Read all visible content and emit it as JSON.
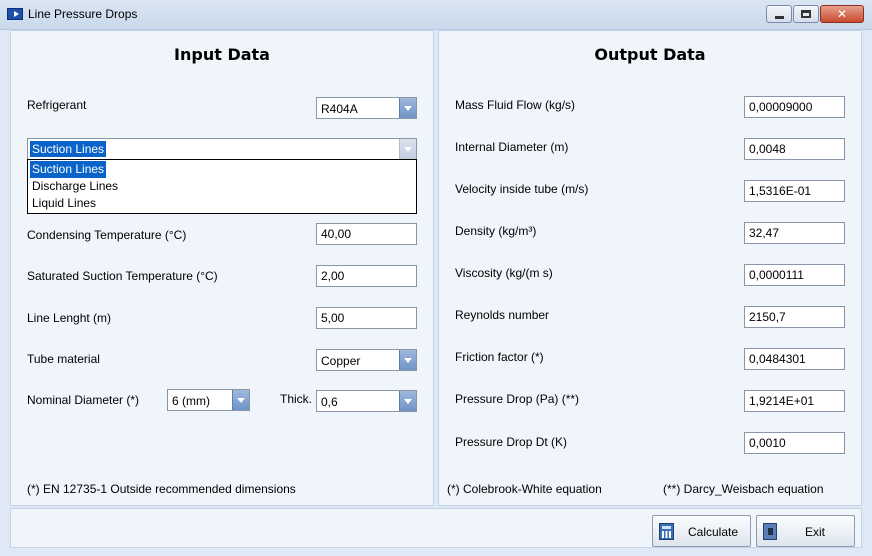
{
  "window": {
    "title": "Line Pressure Drops"
  },
  "input": {
    "heading": "Input Data",
    "refrigerant_label": "Refrigerant",
    "refrigerant_value": "R404A",
    "line_type_value": "Suction Lines",
    "line_type_options": [
      "Suction Lines",
      "Discharge Lines",
      "Liquid Lines"
    ],
    "condensing_label": "Condensing Temperature (°C)",
    "condensing_value": "40,00",
    "suction_temp_label": "Saturated Suction Temperature (°C)",
    "suction_temp_value": "2,00",
    "length_label": "Line Lenght (m)",
    "length_value": "5,00",
    "material_label": "Tube material",
    "material_value": "Copper",
    "diameter_label": "Nominal Diameter (*)",
    "diameter_value": "6 (mm)",
    "thick_label": "Thick.",
    "thick_value": "0,6",
    "footnote": "(*)  EN 12735-1 Outside recommended dimensions"
  },
  "output": {
    "heading": "Output Data",
    "rows": [
      {
        "label": "Mass Fluid Flow (kg/s)",
        "value": "0,00009000"
      },
      {
        "label": "Internal Diameter (m)",
        "value": "0,0048"
      },
      {
        "label": "Velocity inside tube (m/s)",
        "value": "1,5316E-01"
      },
      {
        "label": "Density (kg/m³)",
        "value": "32,47"
      },
      {
        "label": "Viscosity (kg/(m s)",
        "value": "0,0000111"
      },
      {
        "label": "Reynolds number",
        "value": "2150,7"
      },
      {
        "label": "Friction factor (*)",
        "value": "0,0484301"
      },
      {
        "label": "Pressure Drop (Pa) (**)",
        "value": "1,9214E+01"
      },
      {
        "label": "Pressure Drop Dt (K)",
        "value": "0,0010"
      }
    ],
    "footnote_left": "(*) Colebrook-White equation",
    "footnote_right": "(**) Darcy_Weisbach equation"
  },
  "buttons": {
    "calculate": "Calculate",
    "exit": "Exit"
  },
  "icons": {
    "app": "app-arrow-icon",
    "calculate": "calculator-icon",
    "exit": "exit-door-icon"
  }
}
